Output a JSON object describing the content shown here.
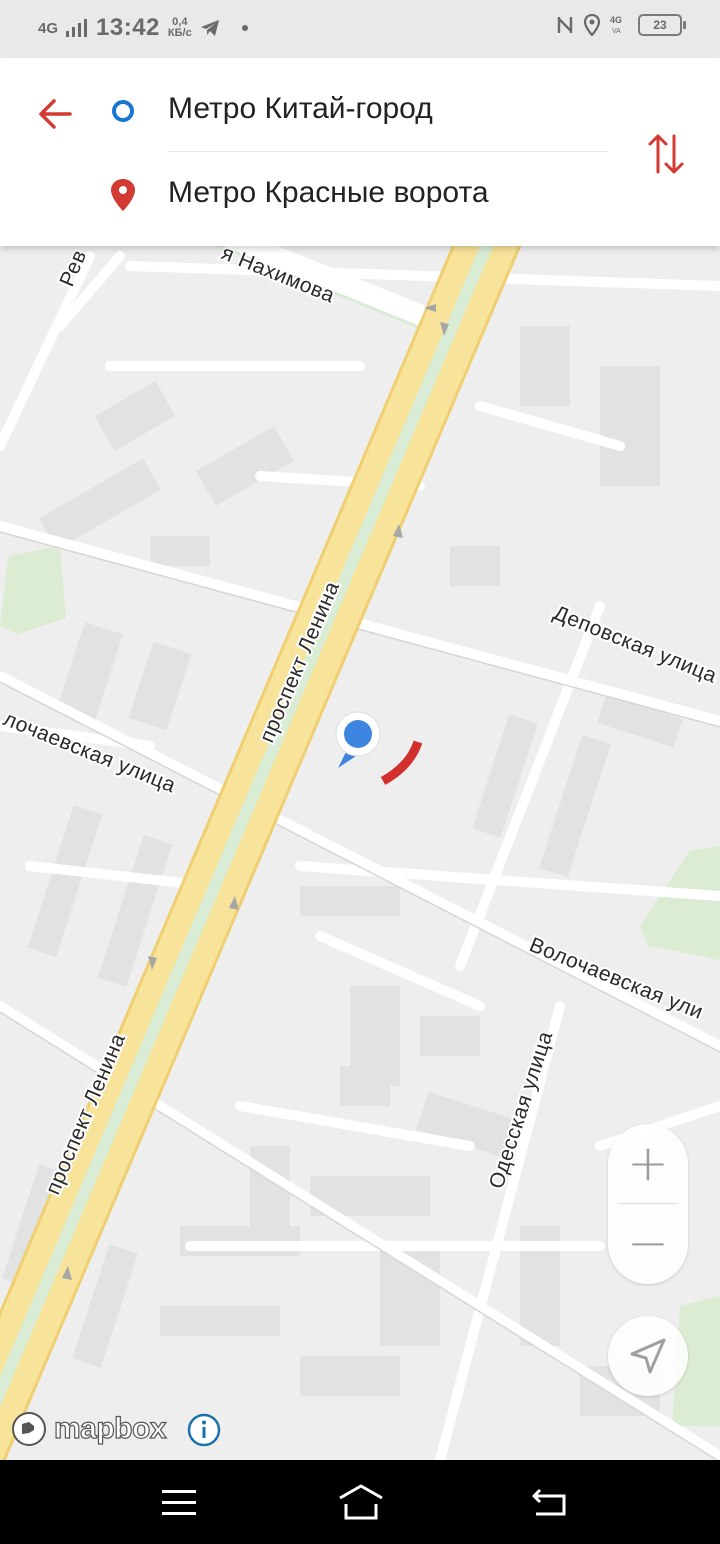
{
  "status_bar": {
    "network": "4G",
    "time": "13:42",
    "speed_value": "0,4",
    "speed_unit": "КБ/с",
    "battery": "23"
  },
  "route": {
    "from": "Метро Китай-город",
    "to": "Метро Красные ворота"
  },
  "map": {
    "streets": {
      "lenina_upper": "проспект Ленина",
      "lenina_lower": "проспект Ленина",
      "nakhimova": "я Нахимова",
      "revolyutsionnaya_fragment": "Рев",
      "depovskaya": "Деповская улица",
      "volochaevskaya_left": "лочаевская улица",
      "volochaevskaya_right": "Волочаевская ули",
      "odesskaya": "Одесская улица"
    },
    "attribution": "mapbox",
    "colors": {
      "main_road": "#f7e39a",
      "median": "#d9ecd6",
      "building": "#e3e3e3",
      "park": "#dcecd2",
      "accent": "#d32f2f",
      "location": "#3d85e0"
    }
  },
  "controls": {
    "zoom_in": "+",
    "zoom_out": "−"
  }
}
